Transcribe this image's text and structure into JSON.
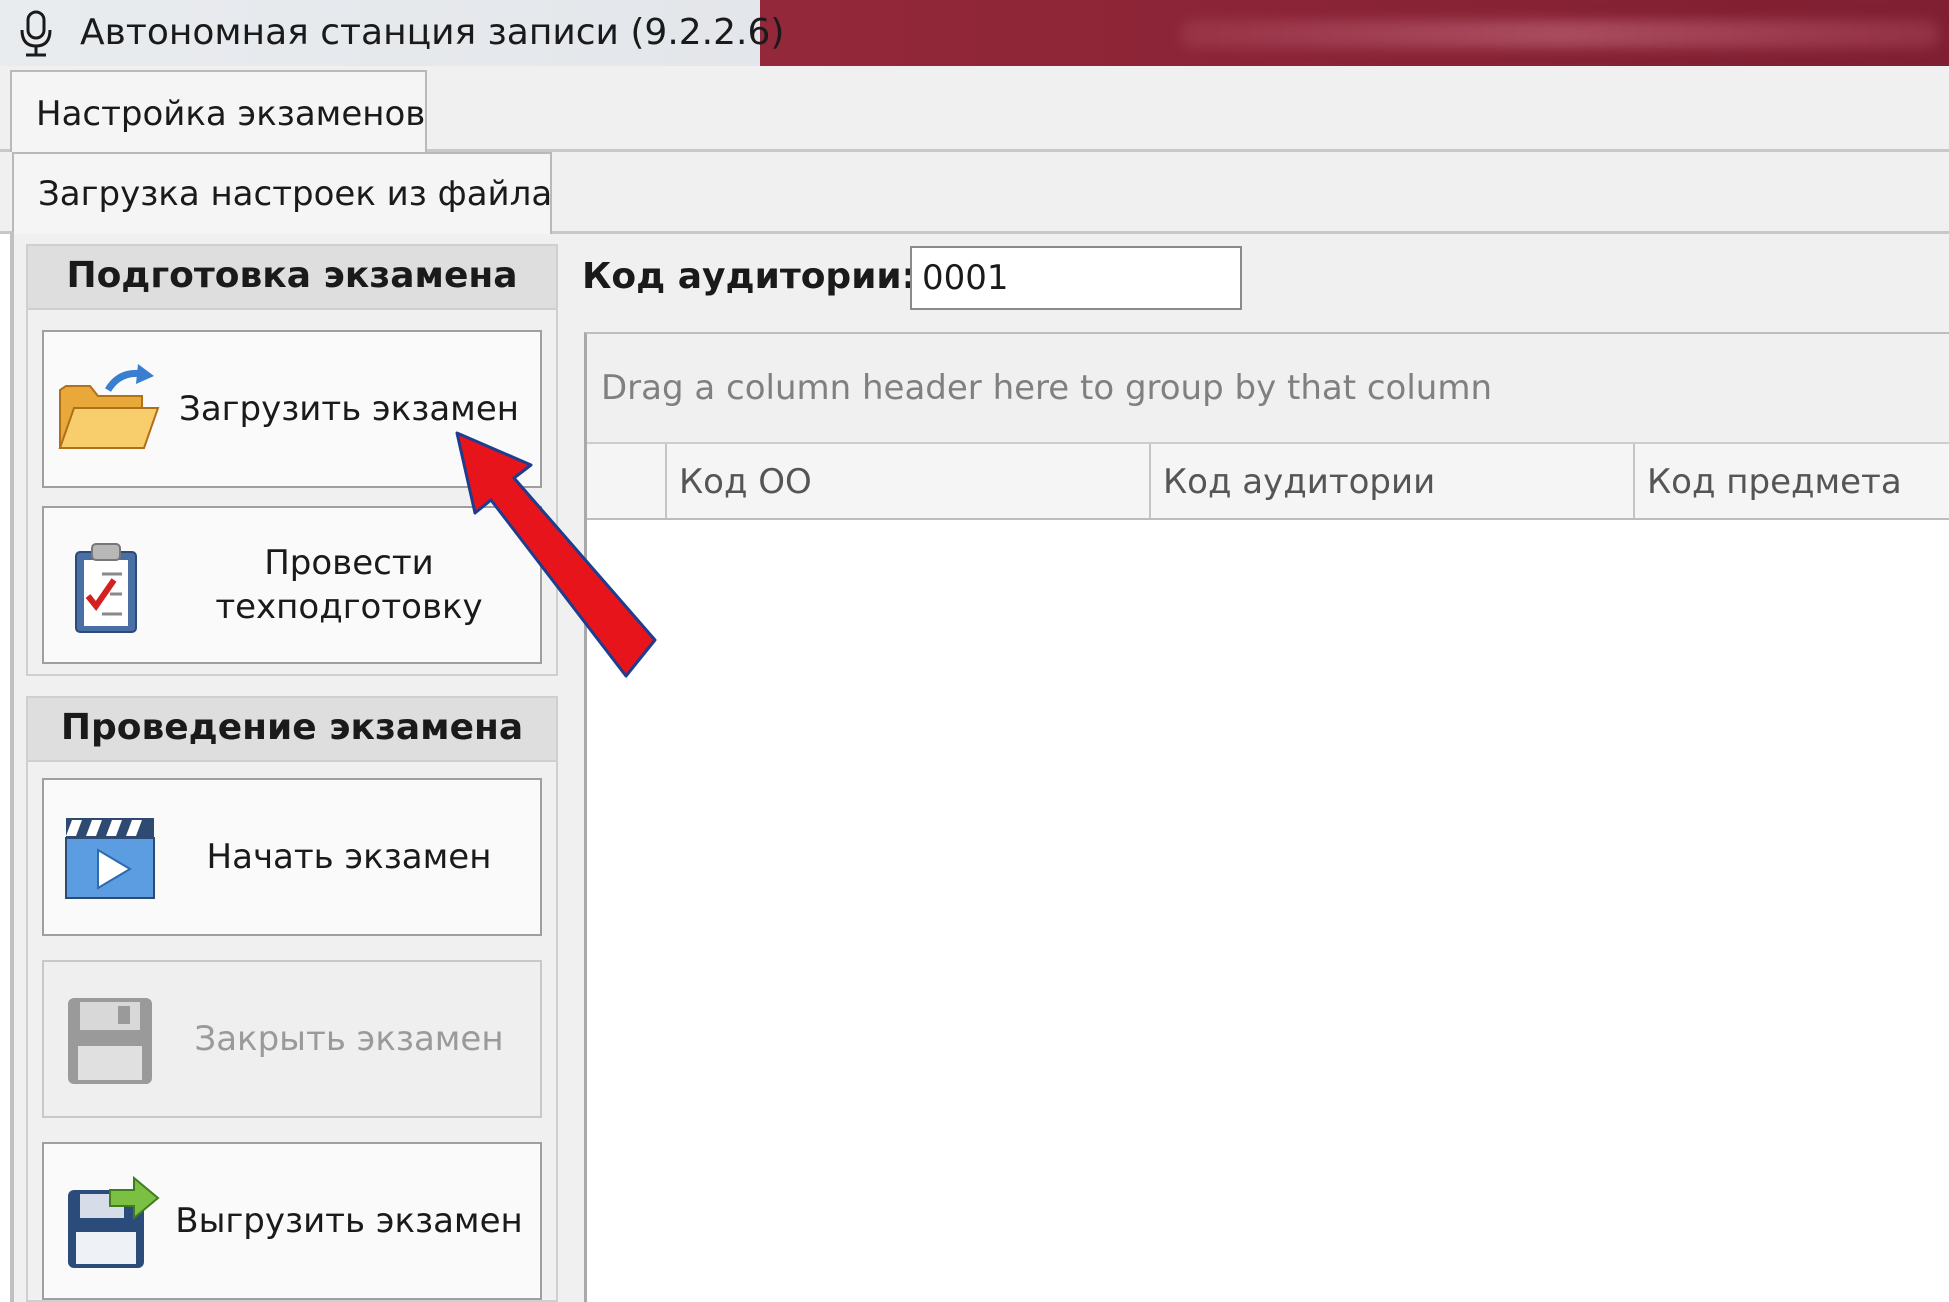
{
  "window": {
    "title": "Автономная станция записи (9.2.2.6)",
    "icon": "microphone-icon"
  },
  "tabs": {
    "primary": "Настройка экзаменов",
    "secondary": "Загрузка настроек из файла"
  },
  "sidebar": {
    "sections": [
      {
        "title": "Подготовка экзамена",
        "buttons": [
          {
            "label": "Загрузить экзамен",
            "icon": "open-folder-icon",
            "enabled": true
          },
          {
            "label": "Провести техподготовку",
            "icon": "clipboard-check-icon",
            "enabled": true
          }
        ]
      },
      {
        "title": "Проведение экзамена",
        "buttons": [
          {
            "label": "Начать экзамен",
            "icon": "play-video-icon",
            "enabled": true
          },
          {
            "label": "Закрыть экзамен",
            "icon": "save-disk-icon",
            "enabled": false
          },
          {
            "label": "Выгрузить экзамен",
            "icon": "export-disk-icon",
            "enabled": true
          }
        ]
      }
    ]
  },
  "main": {
    "room_code_label": "Код аудитории:",
    "room_code_value": "0001",
    "grid": {
      "group_hint": "Drag a column header here to group by that column",
      "columns": [
        "Код ОО",
        "Код аудитории",
        "Код предмета"
      ]
    }
  },
  "colors": {
    "titlebar_accent": "#8b2335",
    "annotation_arrow": "#e8141c"
  }
}
